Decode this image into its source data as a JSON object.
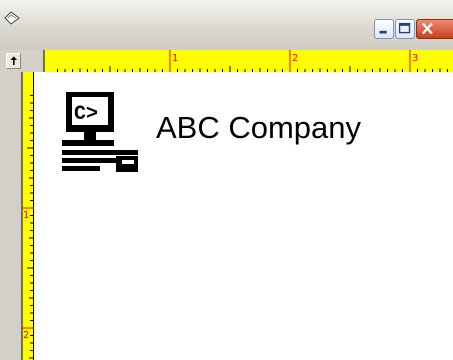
{
  "window": {
    "controls": [
      "minimize",
      "maximize",
      "close"
    ]
  },
  "ruler": {
    "corner_icon": "tab-stop-icon",
    "horizontal_numbers": [
      "1",
      "2",
      "3"
    ],
    "vertical_numbers": [
      "1",
      "2"
    ],
    "color": "#ffff00",
    "number_color": "#ff0000"
  },
  "document": {
    "logo_icon": "computer-c-prompt-icon",
    "logo_prompt": "C>",
    "company_name": "ABC Company"
  }
}
